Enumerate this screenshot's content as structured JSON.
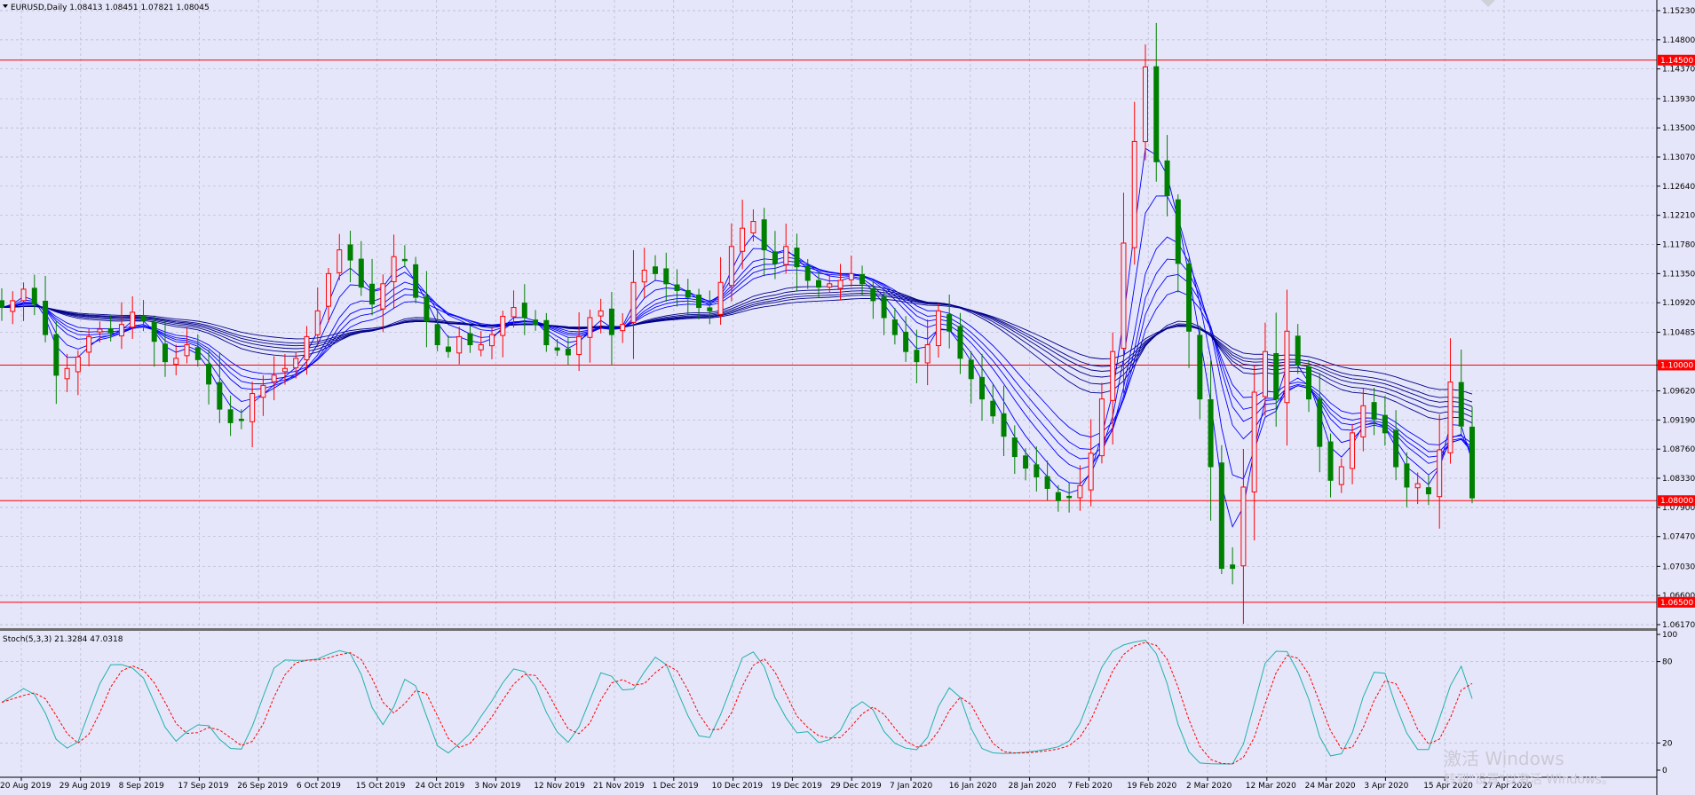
{
  "header": {
    "title": "EURUSD,Daily",
    "ohlc": "1.08413 1.08451 1.07821 1.08045"
  },
  "stoch_header": "Stoch(5,3,3) 21.3284 47.0318",
  "colors": {
    "background": "#e6e6fa",
    "grid": "#b8b8cc",
    "bull": "#ff0000",
    "bear": "#008000",
    "ma": "#00008b",
    "ma_fast": "#0000ff",
    "level_line": "#ff0000",
    "stoch_main": "#20b2aa",
    "stoch_signal": "#ff0000",
    "price_tag_bg": "#ff0000"
  },
  "price_axis": {
    "ticks": [
      "1.15230",
      "1.14800",
      "1.14370",
      "1.13930",
      "1.13500",
      "1.13070",
      "1.12640",
      "1.12210",
      "1.11780",
      "1.11350",
      "1.10920",
      "1.10485",
      "1.10000",
      "1.09620",
      "1.09190",
      "1.08760",
      "1.08330",
      "1.07900",
      "1.07470",
      "1.07030",
      "1.06600",
      "1.06170"
    ],
    "levels": [
      {
        "label": "1.14500",
        "value": 1.145
      },
      {
        "label": "1.10000",
        "value": 1.1
      },
      {
        "label": "1.08000",
        "value": 1.08
      },
      {
        "label": "1.06500",
        "value": 1.065
      }
    ]
  },
  "stoch_axis": {
    "ticks": [
      "100",
      "80",
      "20",
      "0"
    ]
  },
  "date_axis": [
    "20 Aug 2019",
    "29 Aug 2019",
    "8 Sep 2019",
    "17 Sep 2019",
    "26 Sep 2019",
    "6 Oct 2019",
    "15 Oct 2019",
    "24 Oct 2019",
    "3 Nov 2019",
    "12 Nov 2019",
    "21 Nov 2019",
    "1 Dec 2019",
    "10 Dec 2019",
    "19 Dec 2019",
    "29 Dec 2019",
    "7 Jan 2020",
    "16 Jan 2020",
    "28 Jan 2020",
    "7 Feb 2020",
    "19 Feb 2020",
    "2 Mar 2020",
    "12 Mar 2020",
    "24 Mar 2020",
    "3 Apr 2020",
    "15 Apr 2020",
    "27 Apr 2020"
  ],
  "watermark": {
    "line1": "激活 Windows",
    "line2": "转到\"设置\"以激活 Windows。"
  },
  "chart_data": {
    "type": "candlestick",
    "symbol": "EURUSD",
    "timeframe": "Daily",
    "close_path": [
      1.1085,
      1.1095,
      1.1112,
      1.109,
      1.1045,
      1.0985,
      1.0995,
      1.1012,
      1.1042,
      1.1053,
      1.1048,
      1.106,
      1.1078,
      1.1065,
      1.1035,
      1.1005,
      1.101,
      1.103,
      1.1008,
      1.0972,
      1.0935,
      1.0915,
      1.092,
      1.0958,
      1.097,
      1.0985,
      1.0995,
      1.101,
      1.1042,
      1.108,
      1.1135,
      1.117,
      1.1155,
      1.1115,
      1.109,
      1.112,
      1.116,
      1.1155,
      1.11,
      1.1065,
      1.103,
      1.102,
      1.1042,
      1.103,
      1.103,
      1.1045,
      1.1072,
      1.1085,
      1.107,
      1.106,
      1.103,
      1.1022,
      1.1015,
      1.1042,
      1.107,
      1.108,
      1.1045,
      1.106,
      1.1122,
      1.114,
      1.1135,
      1.112,
      1.111,
      1.11,
      1.1085,
      1.108,
      1.1122,
      1.1175,
      1.1202,
      1.1212,
      1.117,
      1.115,
      1.1175,
      1.1145,
      1.1125,
      1.1115,
      1.112,
      1.1125,
      1.1135,
      1.112,
      1.1095,
      1.107,
      1.1045,
      1.102,
      1.1005,
      1.103,
      1.108,
      1.105,
      1.101,
      1.098,
      1.095,
      1.0925,
      1.0895,
      1.0865,
      1.0848,
      1.0835,
      1.0818,
      1.08,
      1.0805,
      1.0822,
      1.087,
      1.095,
      1.102,
      1.118,
      1.133,
      1.144,
      1.13,
      1.125,
      1.115,
      1.105,
      1.095,
      1.085,
      1.07,
      1.07,
      1.082,
      1.096,
      1.102,
      1.095,
      1.105,
      1.1,
      1.095,
      1.088,
      1.083,
      1.085,
      1.09,
      1.094,
      1.092,
      1.09,
      1.085,
      1.082,
      1.0825,
      1.081,
      1.0875,
      1.0975,
      1.091,
      1.0804
    ]
  }
}
